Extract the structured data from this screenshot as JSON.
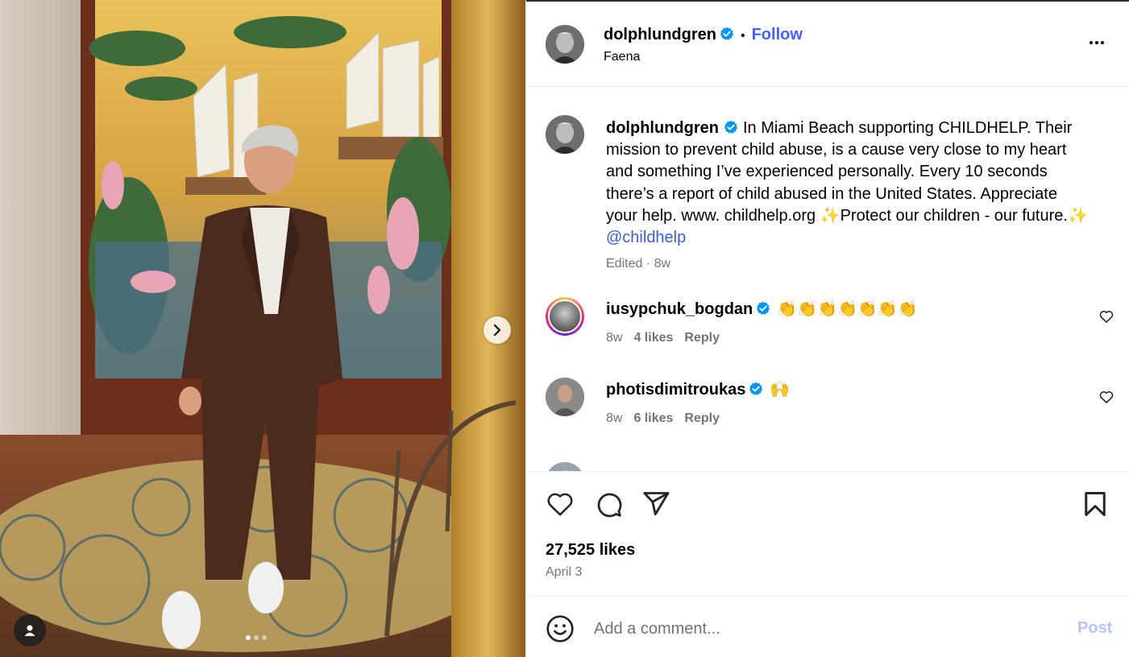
{
  "colors": {
    "accent": "#4460ff",
    "mention": "#3d5bd9",
    "muted": "#737373",
    "post_disabled": "#b3c2ff"
  },
  "header": {
    "username": "dolphlundgren",
    "separator": "•",
    "follow_label": "Follow",
    "location": "Faena",
    "more_icon": "more-horizontal-icon"
  },
  "caption": {
    "username": "dolphlundgren",
    "text": "In Miami Beach supporting CHILDHELP. Their mission to prevent child abuse, is a cause very close to my heart and something I’ve experienced personally. Every 10 seconds there’s a report of child abused in the United States. Appreciate your help. www. childhelp.org ✨Protect our children - our future.✨ ",
    "mention": "@childhelp",
    "meta": "Edited · 8w"
  },
  "comments": [
    {
      "username": "iusypchuk_bogdan",
      "text": "👏👏👏👏👏👏👏",
      "age": "8w",
      "likes": "4 likes",
      "reply": "Reply"
    },
    {
      "username": "photisdimitroukas",
      "text": "🙌",
      "age": "8w",
      "likes": "6 likes",
      "reply": "Reply"
    }
  ],
  "actions": {
    "like_icon": "heart-icon",
    "comment_icon": "comment-icon",
    "share_icon": "share-icon",
    "save_icon": "bookmark-icon",
    "likes": "27,525 likes",
    "date": "April 3"
  },
  "composer": {
    "placeholder": "Add a comment...",
    "post_label": "Post",
    "emoji_icon": "emoji-icon"
  },
  "media": {
    "next_icon": "chevron-right-icon",
    "tag_icon": "user-tag-icon",
    "slide_count": 3,
    "active_slide": 1
  }
}
